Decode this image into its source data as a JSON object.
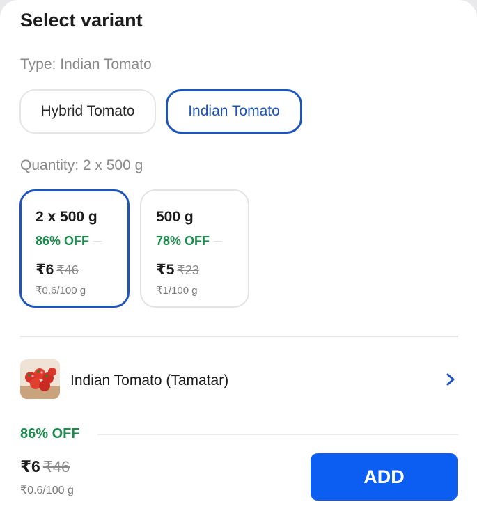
{
  "sheet": {
    "title": "Select variant"
  },
  "type_section": {
    "label": "Type: Indian Tomato",
    "options": [
      {
        "label": "Hybrid Tomato",
        "selected": false
      },
      {
        "label": "Indian Tomato",
        "selected": true
      }
    ]
  },
  "quantity_section": {
    "label": "Quantity: 2 x 500 g",
    "options": [
      {
        "name": "2 x 500 g",
        "discount": "86% OFF",
        "price": "₹6",
        "mrp": "₹46",
        "unit_price": "₹0.6/100 g",
        "selected": true
      },
      {
        "name": "500 g",
        "discount": "78% OFF",
        "price": "₹5",
        "mrp": "₹23",
        "unit_price": "₹1/100 g",
        "selected": false
      }
    ]
  },
  "product": {
    "name": "Indian Tomato (Tamatar)",
    "thumbnail_icon": "tomato-image",
    "chevron_icon": "chevron-right-icon"
  },
  "footer": {
    "discount": "86% OFF",
    "price": "₹6",
    "mrp": "₹46",
    "unit_price": "₹0.6/100 g",
    "add_label": "ADD"
  },
  "colors": {
    "accent_blue": "#1f54b8",
    "button_blue": "#0c5ef2",
    "discount_green": "#1d8a4e"
  }
}
